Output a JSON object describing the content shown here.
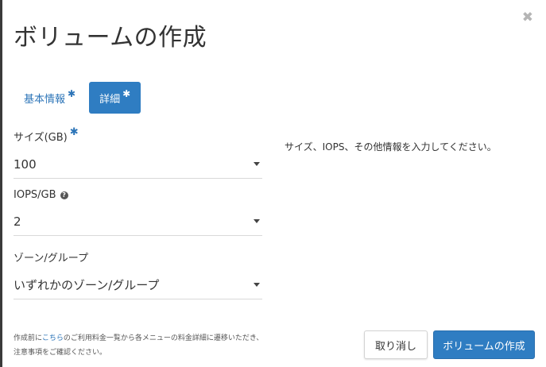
{
  "modal": {
    "title": "ボリュームの作成",
    "close_label": "✖"
  },
  "tabs": [
    {
      "label": "基本情報",
      "required_mark": "✱",
      "active": false
    },
    {
      "label": "詳細",
      "required_mark": "✱",
      "active": true
    }
  ],
  "fields": {
    "size": {
      "label": "サイズ(GB)",
      "required_mark": "✱",
      "value": "100"
    },
    "iops": {
      "label": "IOPS/GB",
      "help_icon": "?",
      "value": "2"
    },
    "zone": {
      "label": "ゾーン/グループ",
      "value": "いずれかのゾーン/グループ"
    }
  },
  "help_text": "サイズ、IOPS、その他情報を入力してください。",
  "footer_note": {
    "prefix": "作成前に",
    "link": "こちら",
    "suffix": "のご利用料金一覧から各メニューの料金詳細に遷移いただき、",
    "line2": "注意事項をご確認ください。"
  },
  "buttons": {
    "cancel": "取り消し",
    "create": "ボリュームの作成"
  },
  "colors": {
    "accent": "#2f7dc2",
    "link": "#2d75b8"
  }
}
